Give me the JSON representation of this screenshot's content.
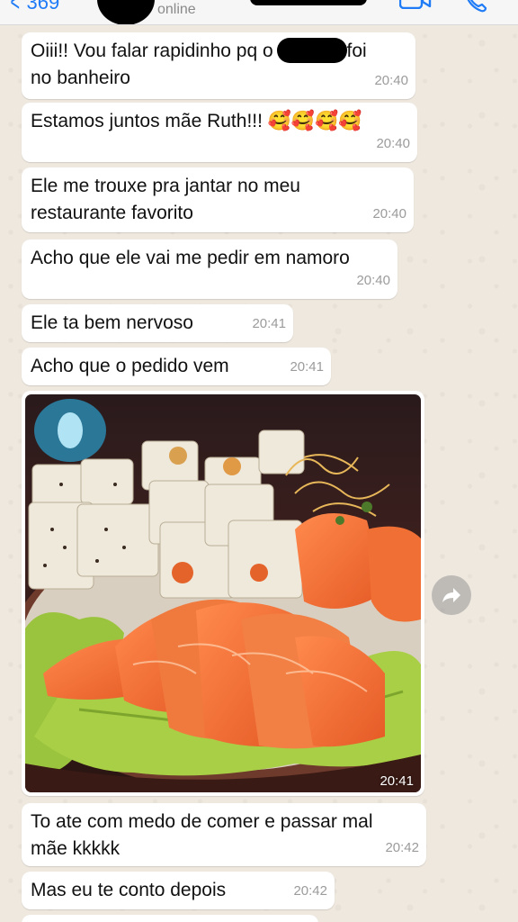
{
  "header": {
    "back_count": "369",
    "status": "online",
    "icons": [
      "chevron-left-icon",
      "video-call-icon",
      "phone-icon"
    ]
  },
  "messages": [
    {
      "line1": "Oiii!! Vou falar rapidinho pq o ",
      "line1_end": "foi",
      "line2": "no banheiro",
      "time": "20:40"
    },
    {
      "text": "Estamos juntos mãe Ruth!!! 🥰🥰🥰🥰",
      "time": "20:40"
    },
    {
      "text": "Ele me trouxe pra jantar no meu\nrestaurante favorito",
      "time": "20:40"
    },
    {
      "text": "Acho que ele vai me pedir em namoro",
      "time": "20:40"
    },
    {
      "text": "Ele ta bem nervoso",
      "time": "20:41"
    },
    {
      "text": "Acho que o pedido vem",
      "time": "20:41"
    },
    {
      "type": "image",
      "description_icon": "sushi-photo",
      "time": "20:41"
    },
    {
      "text": "To ate com medo de comer e passar mal\nmãe kkkkk",
      "time": "20:42"
    },
    {
      "text": "Mas eu te conto depois",
      "time": "20:42"
    }
  ],
  "colors": {
    "accent": "#1f7bf6",
    "bubble": "#ffffff",
    "background": "#efe8df",
    "timestamp": "#9b9b9b"
  }
}
